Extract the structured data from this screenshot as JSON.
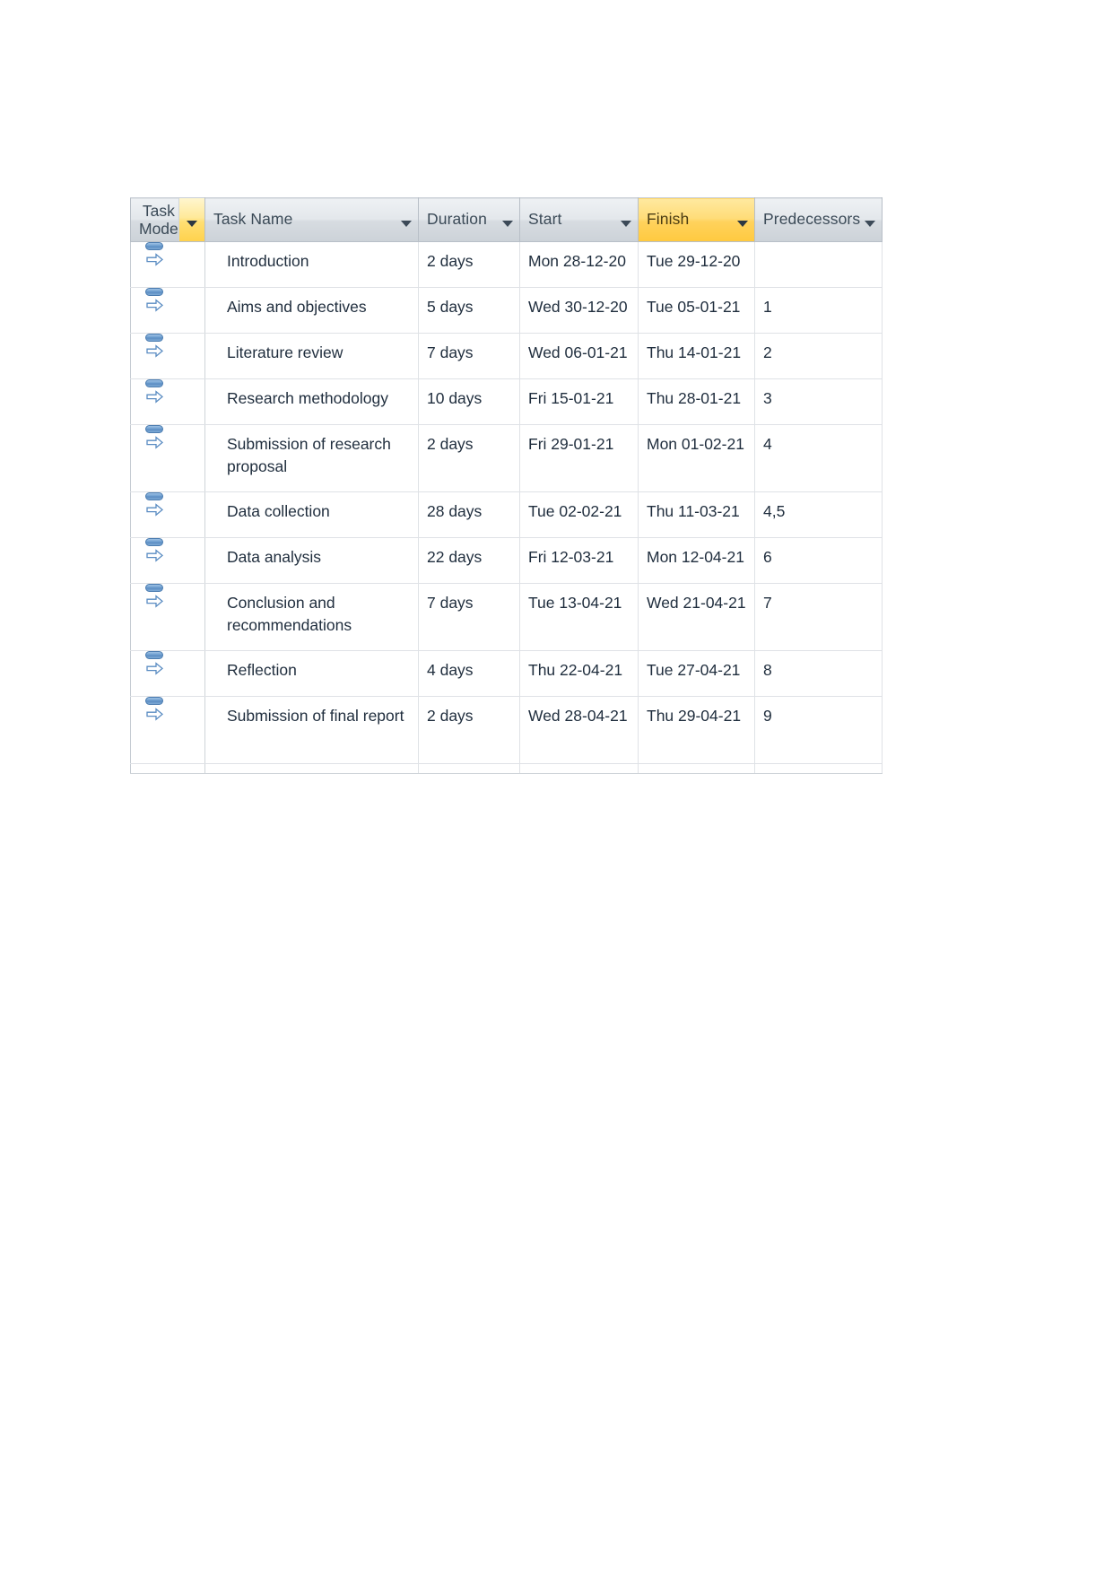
{
  "table": {
    "columns": [
      {
        "key": "task_mode",
        "label": "Task\nMode",
        "label_line1": "Task",
        "label_line2": "Mode",
        "filter_icon": "chevron-down-icon",
        "highlighted": false
      },
      {
        "key": "task_name",
        "label": "Task Name",
        "filter_icon": "chevron-down-icon",
        "highlighted": false
      },
      {
        "key": "duration",
        "label": "Duration",
        "filter_icon": "chevron-down-icon",
        "highlighted": false
      },
      {
        "key": "start",
        "label": "Start",
        "filter_icon": "chevron-down-icon",
        "highlighted": false
      },
      {
        "key": "finish",
        "label": "Finish",
        "filter_icon": "chevron-down-icon",
        "highlighted": true
      },
      {
        "key": "predecessors",
        "label": "Predecessors",
        "filter_icon": "chevron-down-icon",
        "highlighted": false
      }
    ],
    "header_highlight_color": "#ffd24d",
    "header_background_color": "#dde2e7",
    "text_color": "#1f2d3d",
    "task_mode_icon": "auto-scheduled-icon",
    "rows": [
      {
        "task_mode": "auto-scheduled-icon",
        "task_name": "Introduction",
        "duration": "2 days",
        "start": "Mon 28-12-20",
        "finish": "Tue 29-12-20",
        "predecessors": ""
      },
      {
        "task_mode": "auto-scheduled-icon",
        "task_name": "Aims and objectives",
        "duration": "5 days",
        "start": "Wed 30-12-20",
        "finish": "Tue 05-01-21",
        "predecessors": "1"
      },
      {
        "task_mode": "auto-scheduled-icon",
        "task_name": "Literature review",
        "duration": "7 days",
        "start": "Wed 06-01-21",
        "finish": "Thu 14-01-21",
        "predecessors": "2"
      },
      {
        "task_mode": "auto-scheduled-icon",
        "task_name": "Research methodology",
        "duration": "10 days",
        "start": "Fri 15-01-21",
        "finish": "Thu 28-01-21",
        "predecessors": "3"
      },
      {
        "task_mode": "auto-scheduled-icon",
        "task_name": "Submission of research proposal",
        "duration": "2 days",
        "start": "Fri 29-01-21",
        "finish": "Mon 01-02-21",
        "predecessors": "4"
      },
      {
        "task_mode": "auto-scheduled-icon",
        "task_name": "Data collection",
        "duration": "28 days",
        "start": "Tue 02-02-21",
        "finish": "Thu 11-03-21",
        "predecessors": "4,5"
      },
      {
        "task_mode": "auto-scheduled-icon",
        "task_name": "Data analysis",
        "duration": "22 days",
        "start": "Fri 12-03-21",
        "finish": "Mon 12-04-21",
        "predecessors": "6"
      },
      {
        "task_mode": "auto-scheduled-icon",
        "task_name": "Conclusion and recommendations",
        "duration": "7 days",
        "start": "Tue 13-04-21",
        "finish": "Wed 21-04-21",
        "predecessors": "7"
      },
      {
        "task_mode": "auto-scheduled-icon",
        "task_name": "Reflection",
        "duration": "4 days",
        "start": "Thu 22-04-21",
        "finish": "Tue 27-04-21",
        "predecessors": "8"
      },
      {
        "task_mode": "auto-scheduled-icon",
        "task_name": "Submission of final report",
        "duration": "2 days",
        "start": "Wed 28-04-21",
        "finish": "Thu 29-04-21",
        "predecessors": "9"
      }
    ]
  }
}
